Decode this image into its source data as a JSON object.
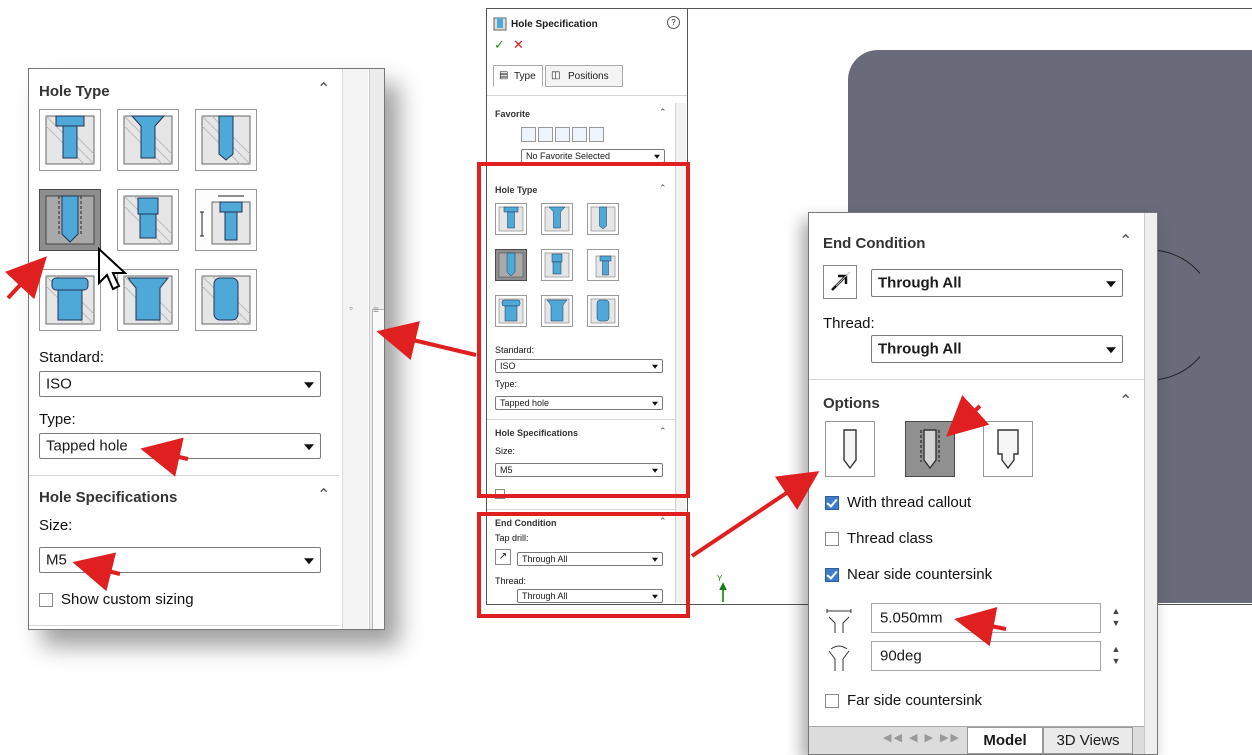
{
  "left_zoom": {
    "hole_type": {
      "title": "Hole Type"
    },
    "standard": {
      "label": "Standard:",
      "value": "ISO"
    },
    "type": {
      "label": "Type:",
      "value": "Tapped hole"
    },
    "hole_specs": {
      "title": "Hole Specifications",
      "size_label": "Size:",
      "size_value": "M5"
    },
    "show_custom_sizing": {
      "label": "Show custom sizing",
      "checked": false
    }
  },
  "center_panel": {
    "title": "Hole Specification",
    "help_icon": "help-icon",
    "tabs": [
      {
        "label": "Type"
      },
      {
        "label": "Positions"
      }
    ],
    "favorite": {
      "title": "Favorite",
      "dropdown": "No Favorite Selected"
    },
    "hole_type": {
      "title": "Hole Type"
    },
    "standard": {
      "label": "Standard:",
      "value": "ISO"
    },
    "type": {
      "label": "Type:",
      "value": "Tapped hole"
    },
    "hole_specs": {
      "title": "Hole Specifications",
      "size_label": "Size:",
      "size_value": "M5"
    },
    "end_condition": {
      "title": "End Condition",
      "tap_drill_label": "Tap drill:",
      "tap_drill_value": "Through All",
      "thread_label": "Thread:",
      "thread_value": "Through All"
    }
  },
  "viewport": {
    "axis_label": "Y"
  },
  "right_zoom": {
    "end_condition": {
      "title": "End Condition",
      "value": "Through All",
      "thread_label": "Thread:",
      "thread_value": "Through All"
    },
    "options": {
      "title": "Options",
      "with_thread_callout": {
        "label": "With thread callout",
        "checked": true
      },
      "thread_class": {
        "label": "Thread class",
        "checked": false
      },
      "near_side_countersink": {
        "label": "Near side countersink",
        "checked": true
      },
      "diameter": {
        "value": "5.050mm"
      },
      "angle": {
        "value": "90deg"
      },
      "far_side_countersink": {
        "label": "Far side countersink",
        "checked": false
      }
    },
    "bottom_tabs": [
      {
        "label": "Model"
      },
      {
        "label": "3D Views"
      }
    ]
  },
  "colors": {
    "accent_red": "#e02020",
    "hole_blue": "#4ea9d8",
    "part_gray": "#6a6b7a",
    "selected_gray": "#8e8e8e"
  }
}
